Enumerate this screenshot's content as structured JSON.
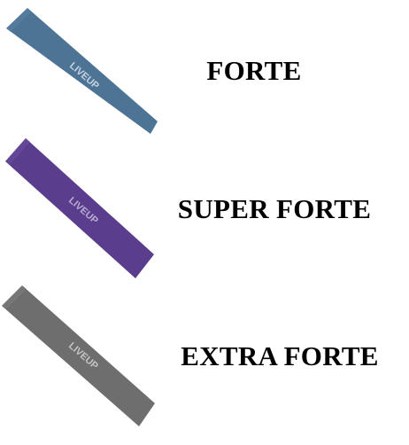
{
  "brand_logo": "LIVEUP",
  "products": [
    {
      "label": "FORTE",
      "color": "#4d7395"
    },
    {
      "label": "SUPER FORTE",
      "color": "#5a3d8c"
    },
    {
      "label": "EXTRA FORTE",
      "color": "#6e6e6e"
    }
  ]
}
